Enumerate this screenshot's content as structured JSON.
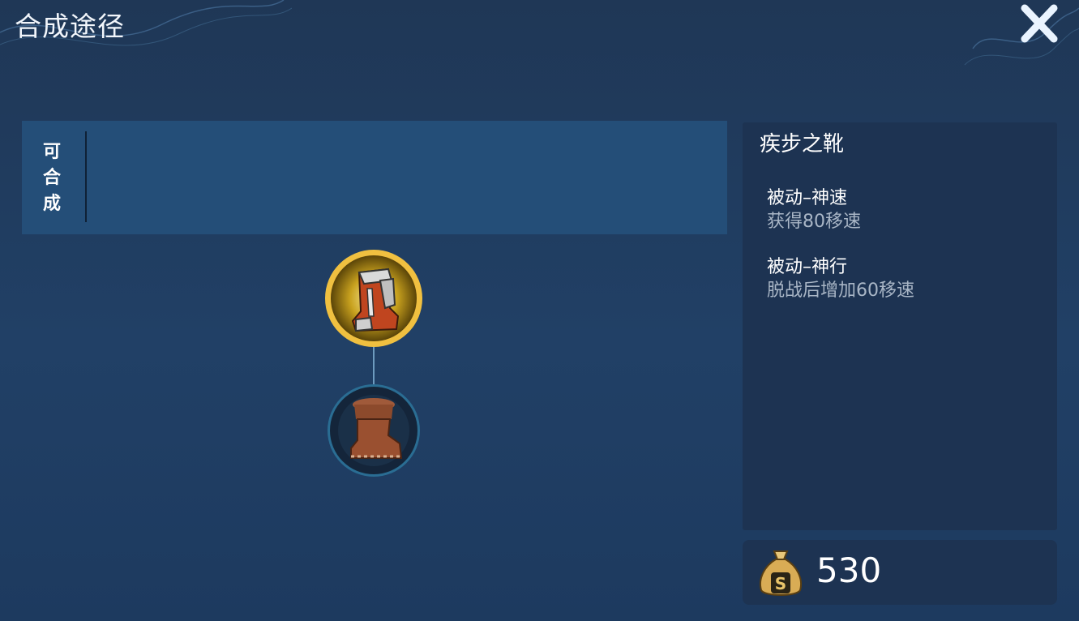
{
  "header": {
    "title": "合成途径"
  },
  "craft_section": {
    "label_chars": [
      "可",
      "合",
      "成"
    ]
  },
  "recipe_tree": {
    "top_item": {
      "icon": "armored-boots-icon"
    },
    "bottom_item": {
      "icon": "leather-boots-icon"
    }
  },
  "item_info": {
    "name": "疾步之靴",
    "passives": [
      {
        "title": "被动–神速",
        "desc": "获得80移速"
      },
      {
        "title": "被动–神行",
        "desc": "脱战后增加60移速"
      }
    ],
    "price": "530"
  },
  "colors": {
    "background": "#214066",
    "panel": "#1d3352",
    "craft_bar": "#244e78",
    "gold_ring": "#f0c040"
  }
}
